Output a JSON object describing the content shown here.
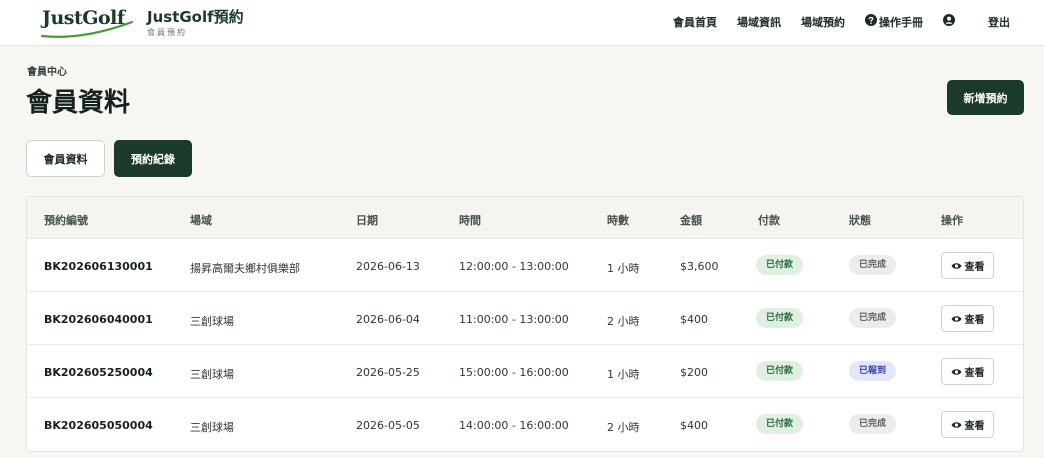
{
  "brand": {
    "logo_text": "JustGolf",
    "title": "JustGolf預約",
    "subtitle": "會員預約"
  },
  "nav": {
    "items": [
      "會員首頁",
      "場域資訊",
      "場域預約",
      "操作手冊"
    ],
    "logout": "登出",
    "icons": {
      "help": "question-circle-icon",
      "account": "user-circle-icon"
    }
  },
  "breadcrumb": "會員中心",
  "page_title": "會員資料",
  "new_booking_label": "新增預約",
  "tabs": {
    "profile": "會員資料",
    "records": "預約紀錄"
  },
  "table": {
    "headers": [
      "預約編號",
      "場域",
      "日期",
      "時間",
      "時數",
      "金額",
      "付款",
      "狀態",
      "操作"
    ],
    "view_label": "查看",
    "rows": [
      {
        "id": "BK202606130001",
        "venue": "揚昇高爾夫鄉村俱樂部",
        "date": "2026-06-13",
        "time": "12:00:00 - 13:00:00",
        "hours": "1 小時",
        "amount": "$3,600",
        "payment": "已付款",
        "status": "已完成",
        "status_type": "done"
      },
      {
        "id": "BK202606040001",
        "venue": "三創球場",
        "date": "2026-06-04",
        "time": "11:00:00 - 13:00:00",
        "hours": "2 小時",
        "amount": "$400",
        "payment": "已付款",
        "status": "已完成",
        "status_type": "done"
      },
      {
        "id": "BK202605250004",
        "venue": "三創球場",
        "date": "2026-05-25",
        "time": "15:00:00 - 16:00:00",
        "hours": "1 小時",
        "amount": "$200",
        "payment": "已付款",
        "status": "已報到",
        "status_type": "checkin"
      },
      {
        "id": "BK202605050004",
        "venue": "三創球場",
        "date": "2026-05-05",
        "time": "14:00:00 - 16:00:00",
        "hours": "2 小時",
        "amount": "$400",
        "payment": "已付款",
        "status": "已完成",
        "status_type": "done"
      }
    ]
  },
  "colors": {
    "primary": "#1b3a2a",
    "paid_bg": "#dff0e2",
    "checkin_bg": "#e4e6fb",
    "done_bg": "#ececea"
  }
}
